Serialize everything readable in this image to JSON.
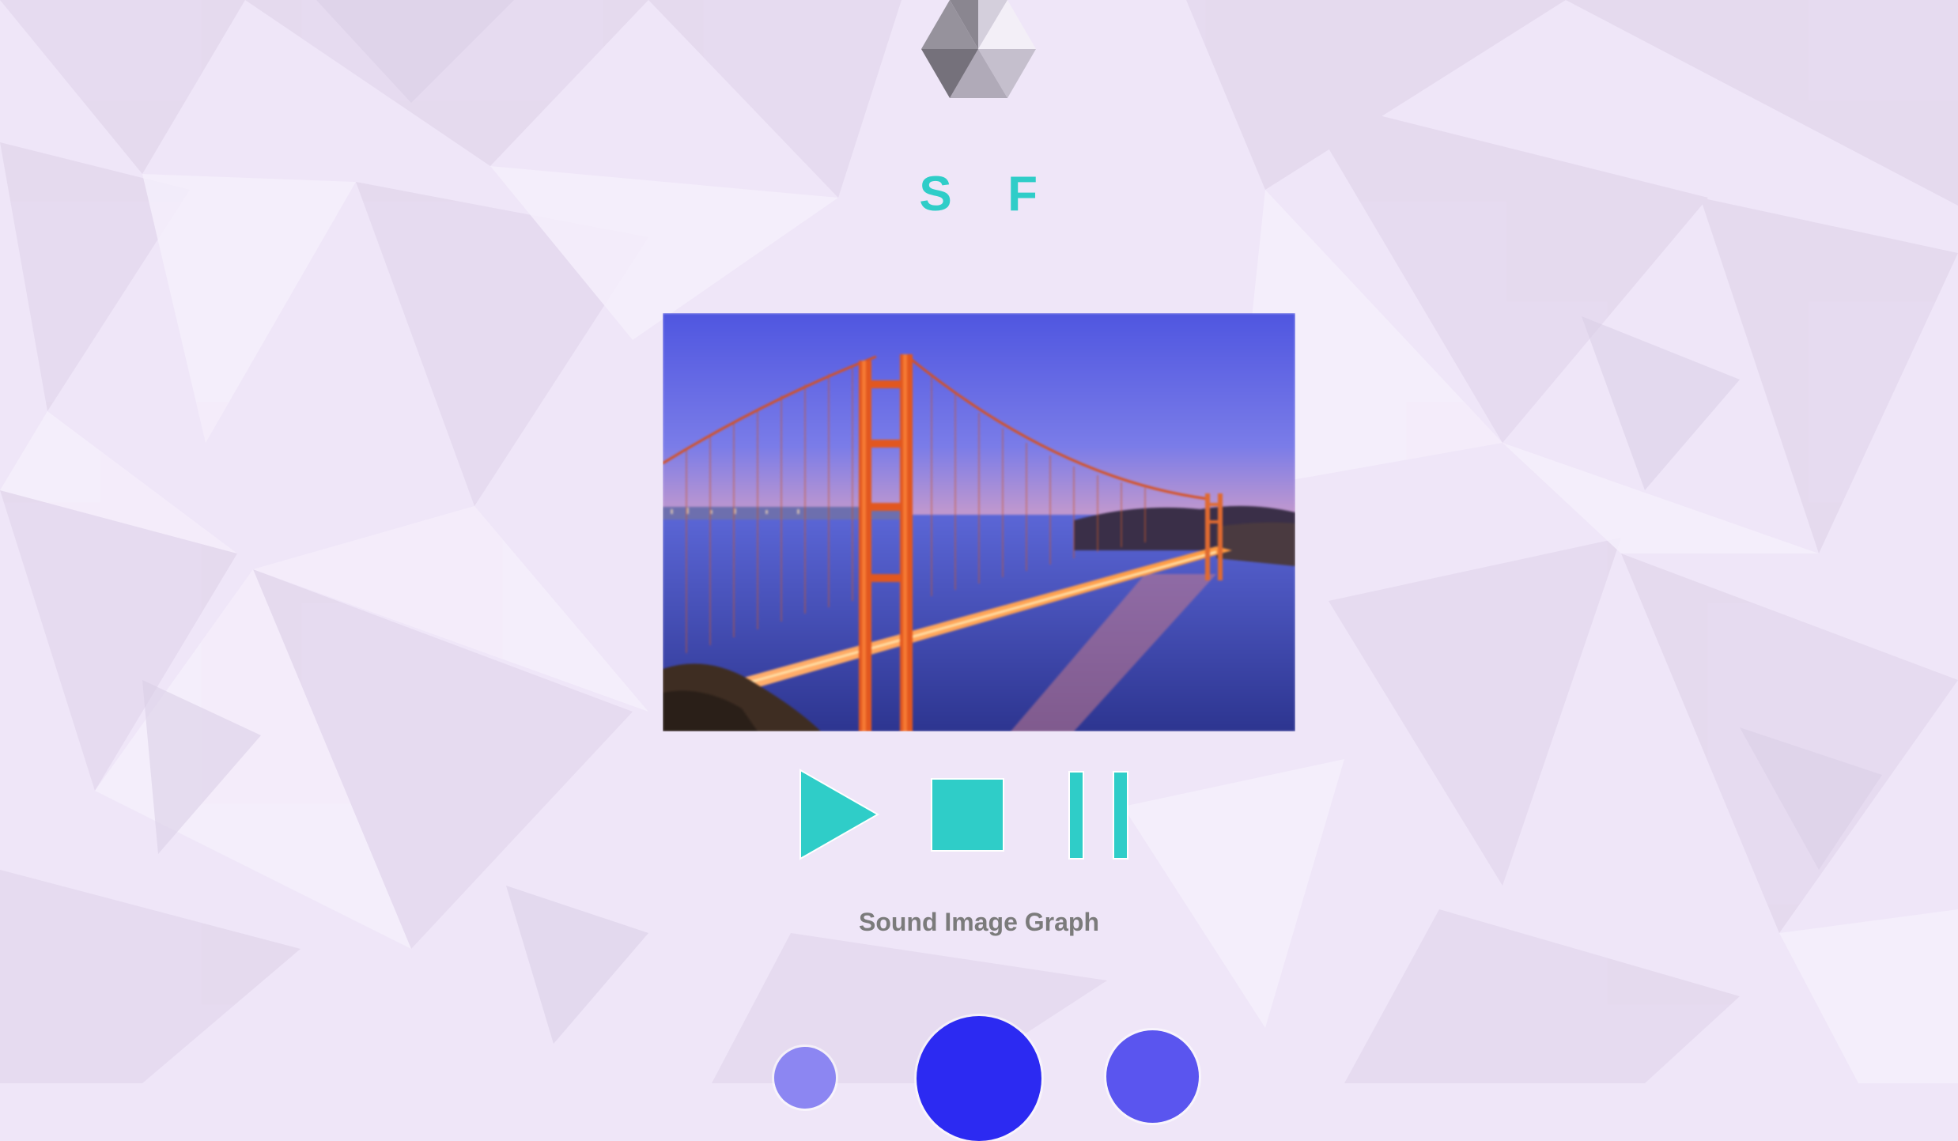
{
  "app": {
    "title_letters": [
      "S",
      "F"
    ],
    "caption": "Sound Image Graph"
  },
  "icons": {
    "logo": "hexagon-logo-icon",
    "play": "play-icon",
    "stop": "stop-icon",
    "pause": "pause-icon"
  },
  "colors": {
    "background": "#efe6f8",
    "accent": "#2fcdc8",
    "caption": "#7b7b7b",
    "dot_light": "#8c86f2",
    "dot_main": "#2c2af2",
    "dot_mid": "#5a55ef"
  },
  "media": {
    "image_subject": "golden-gate-bridge-photo"
  }
}
